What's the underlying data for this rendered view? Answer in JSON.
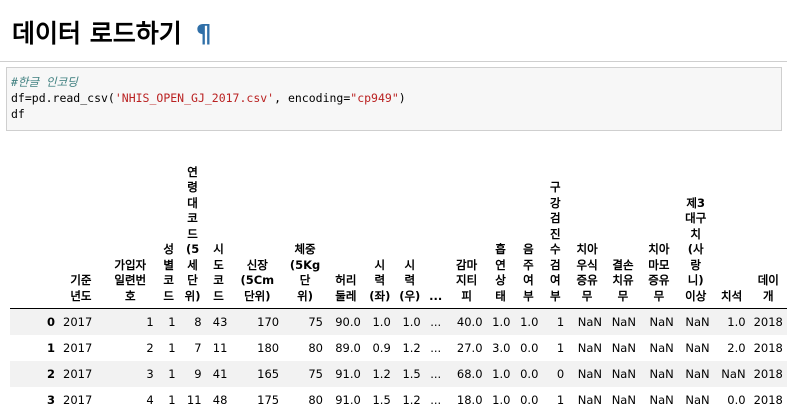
{
  "heading": {
    "title": "데이터 로드하기",
    "anchor": "¶"
  },
  "code": {
    "comment": "#한글 인코딩",
    "line2_prefix": "df=pd.read_csv(",
    "filename": "'NHIS_OPEN_GJ_2017.csv'",
    "line2_mid": ", encoding=",
    "encoding": "\"cp949\"",
    "line2_suffix": ")",
    "line3": "df"
  },
  "table": {
    "columns": [
      "",
      "기준\n년도",
      "가입자\n일련번\n호",
      "성별\n코드",
      "연\n령\n대\n코\n드\n(5\n세\n단\n위)",
      "시\n도\n코\n드",
      "신장\n(5Cm\n단위)",
      "체중\n(5Kg\n단\n위)",
      "허리\n둘레",
      "시\n력\n(좌)",
      "시\n력\n(우)",
      "...",
      "감마\n지티\n피",
      "흡\n연\n상\n태",
      "음\n주\n여\n부",
      "구\n강\n검\n진\n수\n검\n여\n부",
      "치아\n우식\n증유\n무",
      "결손\n치유\n무",
      "치아\n마모\n증유\n무",
      "제3\n대구\n치\n(사\n랑\n니)\n이상",
      "치석",
      "데이\n개"
    ],
    "rows": [
      [
        "0",
        "2017",
        "1",
        "1",
        "8",
        "43",
        "170",
        "75",
        "90.0",
        "1.0",
        "1.0",
        "...",
        "40.0",
        "1.0",
        "1.0",
        "1",
        "NaN",
        "NaN",
        "NaN",
        "NaN",
        "1.0",
        "2018"
      ],
      [
        "1",
        "2017",
        "2",
        "1",
        "7",
        "11",
        "180",
        "80",
        "89.0",
        "0.9",
        "1.2",
        "...",
        "27.0",
        "3.0",
        "0.0",
        "1",
        "NaN",
        "NaN",
        "NaN",
        "NaN",
        "2.0",
        "2018"
      ],
      [
        "2",
        "2017",
        "3",
        "1",
        "9",
        "41",
        "165",
        "75",
        "91.0",
        "1.2",
        "1.5",
        "...",
        "68.0",
        "1.0",
        "0.0",
        "0",
        "NaN",
        "NaN",
        "NaN",
        "NaN",
        "NaN",
        "2018"
      ],
      [
        "3",
        "2017",
        "4",
        "1",
        "11",
        "48",
        "175",
        "80",
        "91.0",
        "1.5",
        "1.2",
        "...",
        "18.0",
        "1.0",
        "0.0",
        "1",
        "NaN",
        "NaN",
        "NaN",
        "NaN",
        "0.0",
        "2018"
      ]
    ]
  }
}
